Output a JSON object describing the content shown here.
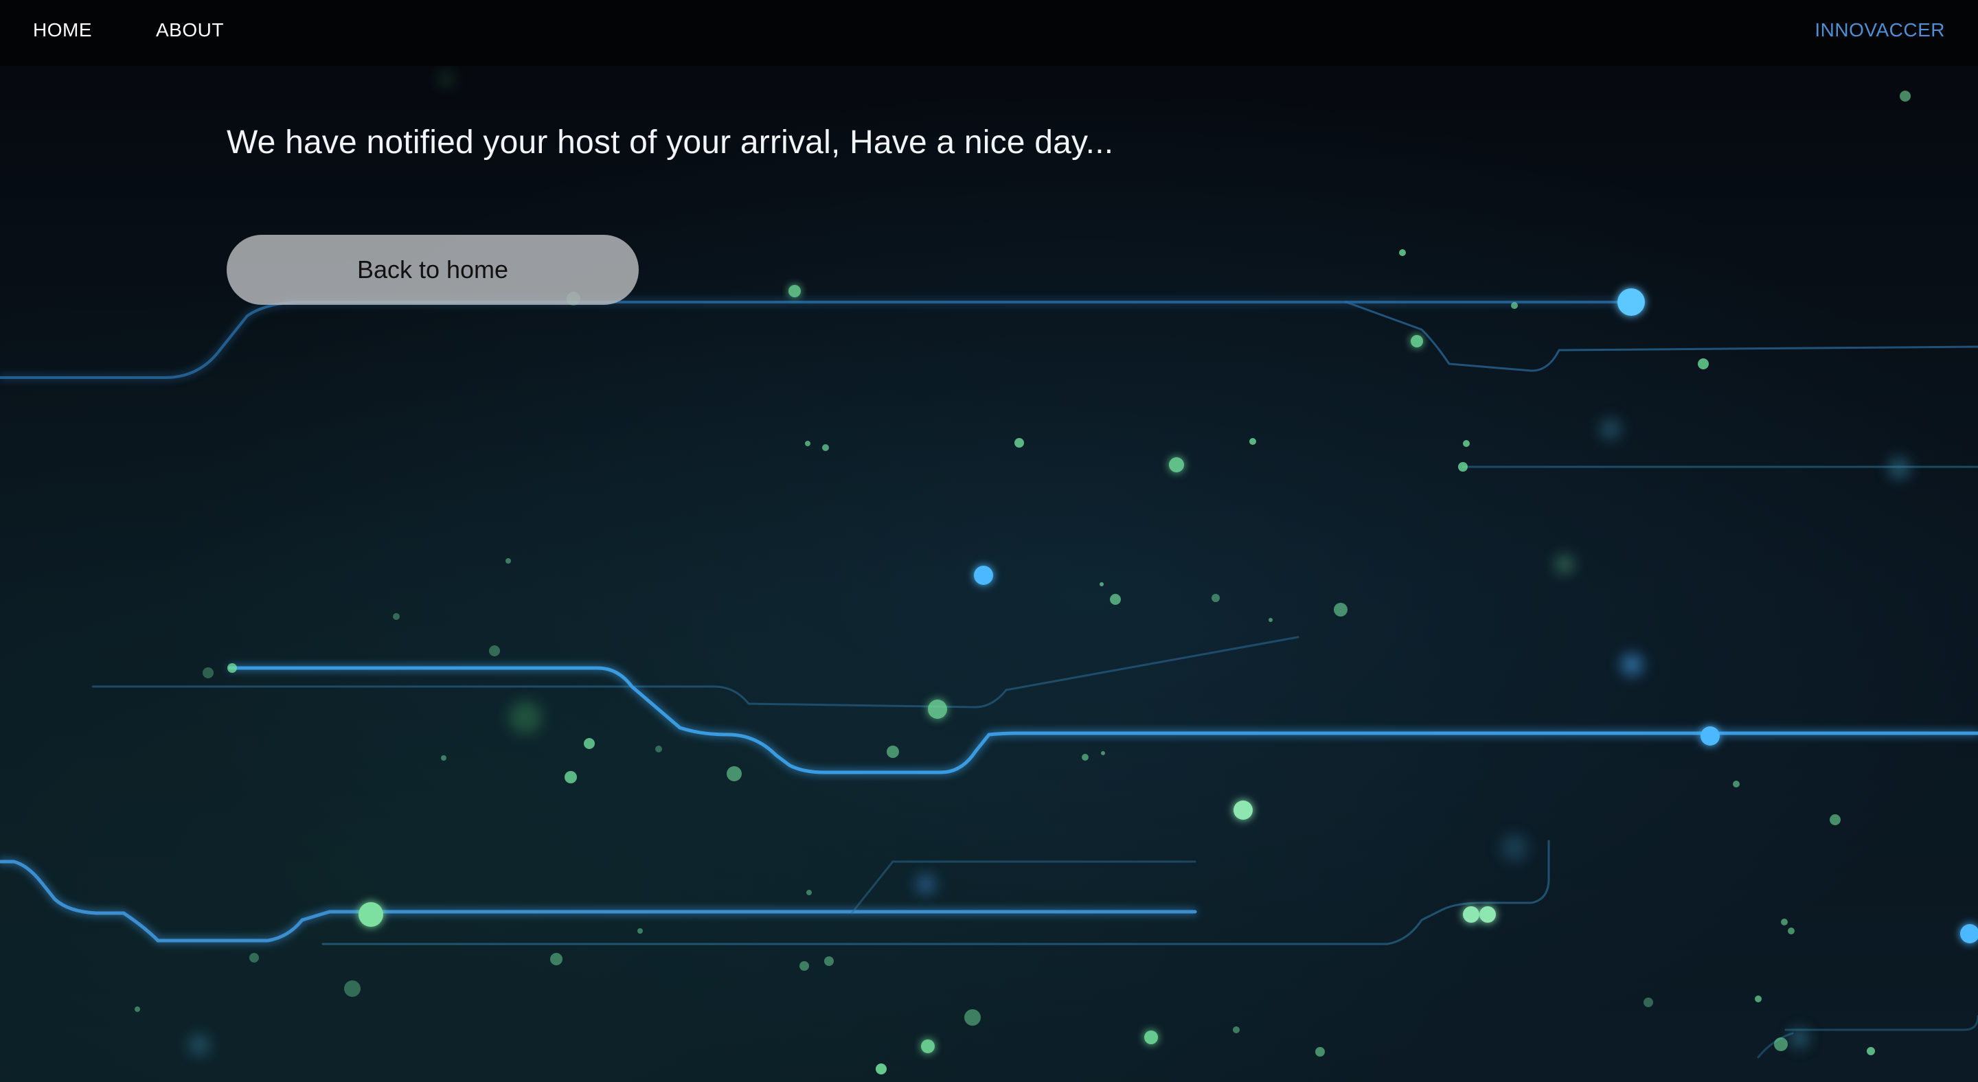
{
  "nav": {
    "home_label": "HOME",
    "about_label": "ABOUT",
    "brand_label": "INNOVACCER"
  },
  "main": {
    "message": "We have notified your host of your arrival, Have a nice day...",
    "back_button_label": "Back to home"
  },
  "colors": {
    "navbar_bg": "#030405",
    "brand": "#4e8fd6",
    "circuit_line": "#3aa6e8",
    "particle": "#6fdc9a",
    "button_bg": "#b9bcbe"
  }
}
